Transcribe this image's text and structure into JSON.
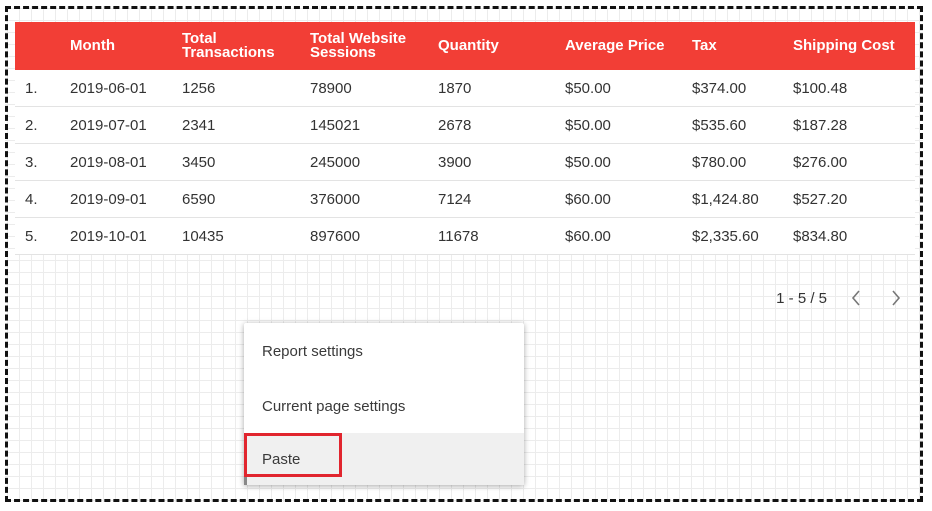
{
  "table": {
    "columns": [
      "",
      "Month",
      "Total Transactions",
      "Total Website Sessions",
      "Quantity",
      "Average Price",
      "Tax",
      "Shipping Cost"
    ],
    "rows": [
      [
        "1.",
        "2019-06-01",
        "1256",
        "78900",
        "1870",
        "$50.00",
        "$374.00",
        "$100.48"
      ],
      [
        "2.",
        "2019-07-01",
        "2341",
        "145021",
        "2678",
        "$50.00",
        "$535.60",
        "$187.28"
      ],
      [
        "3.",
        "2019-08-01",
        "3450",
        "245000",
        "3900",
        "$50.00",
        "$780.00",
        "$276.00"
      ],
      [
        "4.",
        "2019-09-01",
        "6590",
        "376000",
        "7124",
        "$60.00",
        "$1,424.80",
        "$527.20"
      ],
      [
        "5.",
        "2019-10-01",
        "10435",
        "897600",
        "11678",
        "$60.00",
        "$2,335.60",
        "$834.80"
      ]
    ],
    "header_color": "#f23e36"
  },
  "pagination": {
    "label": "1 - 5 / 5",
    "prev_icon": "‹",
    "next_icon": "›"
  },
  "context_menu": {
    "items": [
      "Report settings",
      "Current page settings",
      "Paste"
    ],
    "highlight_color": "#e1252e"
  }
}
